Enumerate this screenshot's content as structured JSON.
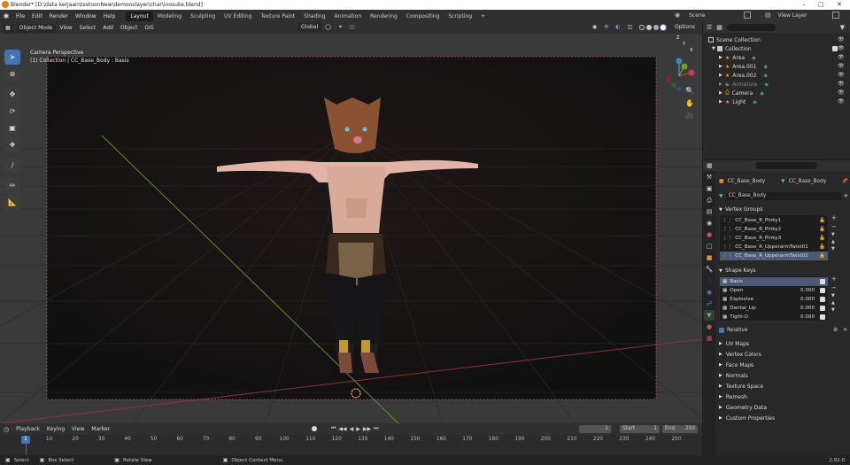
{
  "window": {
    "title": "Blender* [D:\\data kerjaan\\testoonNew\\demonslayer\\char\\inosuke.blend]"
  },
  "menu": [
    "File",
    "Edit",
    "Render",
    "Window",
    "Help"
  ],
  "workspaces": [
    "Layout",
    "Modeling",
    "Sculpting",
    "UV Editing",
    "Texture Paint",
    "Shading",
    "Animation",
    "Rendering",
    "Compositing",
    "Scripting"
  ],
  "workspace_add": "+",
  "scene": {
    "label": "Scene",
    "view_layer": "View Layer"
  },
  "viewport": {
    "mode": "Object Mode",
    "menus": [
      "View",
      "Select",
      "Add",
      "Object",
      "GIS"
    ],
    "orientation": "Global",
    "options": "Options",
    "overlay_line1": "Camera Perspective",
    "overlay_line2": "(1) Collection | CC_Base_Body : Basis",
    "gizmo_axes": {
      "x": "X",
      "y": "Y",
      "z": "Z"
    }
  },
  "outliner": {
    "root": "Scene Collection",
    "collection": "Collection",
    "items": [
      {
        "name": "Area",
        "icon": "light-icon"
      },
      {
        "name": "Area.001",
        "icon": "light-icon"
      },
      {
        "name": "Area.002",
        "icon": "light-icon"
      },
      {
        "name": "Armature",
        "icon": "armature-icon"
      },
      {
        "name": "Camera",
        "icon": "camera-icon"
      },
      {
        "name": "Light",
        "icon": "light-icon"
      }
    ]
  },
  "properties": {
    "object_name": "CC_Base_Body",
    "mesh_name": "CC_Base_Body",
    "data_name": "CC_Base_Body",
    "vertex_groups_title": "Vertex Groups",
    "vertex_groups": [
      "CC_Base_R_Pinky1",
      "CC_Base_R_Pinky2",
      "CC_Base_R_Pinky3",
      "CC_Base_R_UpperarmTwist01",
      "CC_Base_R_UpperarmTwist02"
    ],
    "shape_keys_title": "Shape Keys",
    "shape_keys": [
      {
        "name": "Basis",
        "value": ""
      },
      {
        "name": "Open",
        "value": "0.000"
      },
      {
        "name": "Explosive",
        "value": "0.000"
      },
      {
        "name": "Dental_Lip",
        "value": "0.000"
      },
      {
        "name": "Tight-O",
        "value": "0.000"
      }
    ],
    "relative_label": "Relative",
    "collapsed_sections": [
      "UV Maps",
      "Vertex Colors",
      "Face Maps",
      "Normals",
      "Texture Space",
      "Remesh",
      "Geometry Data",
      "Custom Properties"
    ]
  },
  "timeline": {
    "menus": [
      "Playback",
      "Keying",
      "View",
      "Marker"
    ],
    "current_frame": "1",
    "start_label": "Start",
    "start": "1",
    "end_label": "End",
    "end": "250",
    "ticks": [
      "1",
      "10",
      "20",
      "30",
      "40",
      "50",
      "60",
      "70",
      "80",
      "90",
      "100",
      "110",
      "120",
      "130",
      "140",
      "150",
      "160",
      "170",
      "180",
      "190",
      "200",
      "210",
      "220",
      "230",
      "240",
      "250"
    ],
    "playhead": "1"
  },
  "statusbar": {
    "select": "Select",
    "box_select": "Box Select",
    "rotate_view": "Rotate View",
    "context_menu": "Object Context Menu",
    "version": "2.91.0"
  },
  "colors": {
    "accent": "#4772b3",
    "grid_x": "#a04050",
    "grid_y": "#7a9a30",
    "active_frame": "#4772b3"
  }
}
